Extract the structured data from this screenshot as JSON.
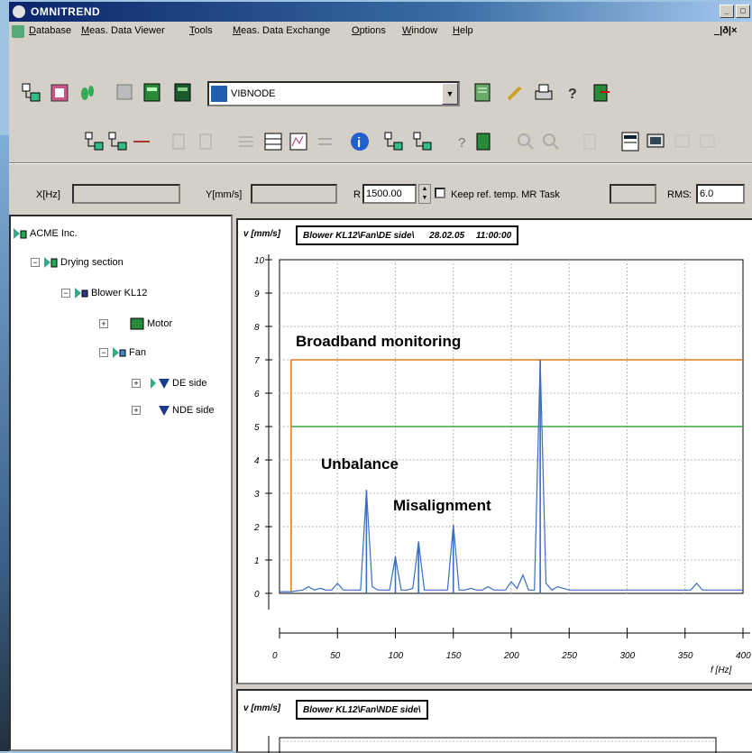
{
  "window": {
    "title": "OMNITREND",
    "buttons": [
      "_",
      "□",
      "×"
    ]
  },
  "menubar": {
    "items": [
      "Database",
      "Meas. Data Viewer",
      "Tools",
      "Meas. Data Exchange",
      "Options",
      "Window",
      "Help"
    ],
    "mdi_controls": "_|ð|×"
  },
  "toolbar": {
    "combo_value": "VIBNODE"
  },
  "coordbar": {
    "x_label": "X[Hz]",
    "x_value": "",
    "y_label": "Y[mm/s]",
    "y_value": "",
    "r_label": "R",
    "r_value": "1500.00",
    "keep_label": "Keep ref. temp. MR Task",
    "keep_value": "",
    "rms_label": "RMS",
    "rms_value": "6.0"
  },
  "tree": [
    {
      "label": "ACME Inc.",
      "icon": "company-icon",
      "expander": ""
    },
    {
      "label": "Drying section",
      "icon": "section-icon",
      "expander": "−"
    },
    {
      "label": "Blower KL12",
      "icon": "machine-icon",
      "expander": "−"
    },
    {
      "label": "Motor",
      "icon": "motor-icon",
      "expander": "+"
    },
    {
      "label": "Fan",
      "icon": "fan-icon",
      "expander": "−"
    },
    {
      "label": "DE side",
      "icon": "measpoint-icon",
      "expander": "+"
    },
    {
      "label": "NDE side",
      "icon": "measpoint-icon",
      "expander": "+"
    }
  ],
  "spectrum": {
    "ylabel": "v [mm/s]",
    "header": "Blower KL12\\Fan\\DE side\\",
    "date": "28.02.05",
    "time": "11:00:00",
    "xlabel": "f [Hz]",
    "annotations": {
      "broadband": "Broadband monitoring",
      "unbalance": "Unbalance",
      "misalignment": "Misalignment"
    },
    "colors": {
      "alarm": "#e07a1a",
      "warning": "#3aa83a",
      "trace": "#3a6fc4"
    }
  },
  "chart_data": {
    "type": "line",
    "title": "Blower KL12\\Fan\\DE side\\",
    "xlabel": "f [Hz]",
    "ylabel": "v [mm/s]",
    "xlim": [
      0,
      400
    ],
    "ylim": [
      0,
      10
    ],
    "x_ticks": [
      0,
      50,
      100,
      150,
      200,
      250,
      300,
      350,
      400
    ],
    "y_ticks": [
      0,
      1,
      2,
      3,
      4,
      5,
      6,
      7,
      8,
      9,
      10
    ],
    "grid": true,
    "thresholds": [
      {
        "value": 7.0,
        "color": "#e07a1a"
      },
      {
        "value": 5.0,
        "color": "#3aa83a"
      }
    ],
    "series": [
      {
        "x": [
          0,
          10,
          20,
          25,
          30,
          35,
          40,
          45,
          50,
          55,
          60,
          65,
          70,
          75,
          80,
          85,
          90,
          95,
          100,
          105,
          110,
          115,
          120,
          125,
          130,
          135,
          140,
          145,
          150,
          155,
          160,
          165,
          170,
          175,
          180,
          185,
          190,
          195,
          200,
          205,
          210,
          215,
          220,
          225,
          230,
          235,
          240,
          245,
          250,
          255,
          260,
          265,
          270,
          275,
          280,
          285,
          290,
          295,
          300,
          305,
          310,
          315,
          320,
          325,
          330,
          335,
          340,
          345,
          350,
          355,
          360,
          365,
          370,
          375,
          380,
          385,
          390,
          395,
          400
        ],
        "y": [
          0.05,
          0.05,
          0.1,
          0.2,
          0.1,
          0.15,
          0.1,
          0.1,
          0.3,
          0.1,
          0.1,
          0.1,
          0.1,
          3.1,
          0.2,
          0.1,
          0.1,
          0.1,
          1.1,
          0.1,
          0.1,
          0.15,
          1.55,
          0.1,
          0.1,
          0.1,
          0.1,
          0.1,
          2.05,
          0.1,
          0.1,
          0.15,
          0.1,
          0.1,
          0.2,
          0.1,
          0.1,
          0.1,
          0.35,
          0.15,
          0.55,
          0.1,
          0.1,
          7.0,
          0.3,
          0.1,
          0.2,
          0.15,
          0.1,
          0.1,
          0.1,
          0.1,
          0.1,
          0.1,
          0.1,
          0.1,
          0.1,
          0.1,
          0.1,
          0.1,
          0.1,
          0.1,
          0.1,
          0.1,
          0.1,
          0.1,
          0.1,
          0.1,
          0.1,
          0.1,
          0.3,
          0.1,
          0.1,
          0.1,
          0.1,
          0.1,
          0.1,
          0.1,
          0.1
        ]
      }
    ],
    "peaks": [
      {
        "x": 75,
        "y": 3.1
      },
      {
        "x": 100,
        "y": 1.1
      },
      {
        "x": 120,
        "y": 1.55
      },
      {
        "x": 150,
        "y": 2.05
      },
      {
        "x": 225,
        "y": 7.0
      }
    ]
  },
  "spectrum2": {
    "ylabel": "v [mm/s]",
    "header": "Blower KL12\\Fan\\NDE side\\"
  }
}
